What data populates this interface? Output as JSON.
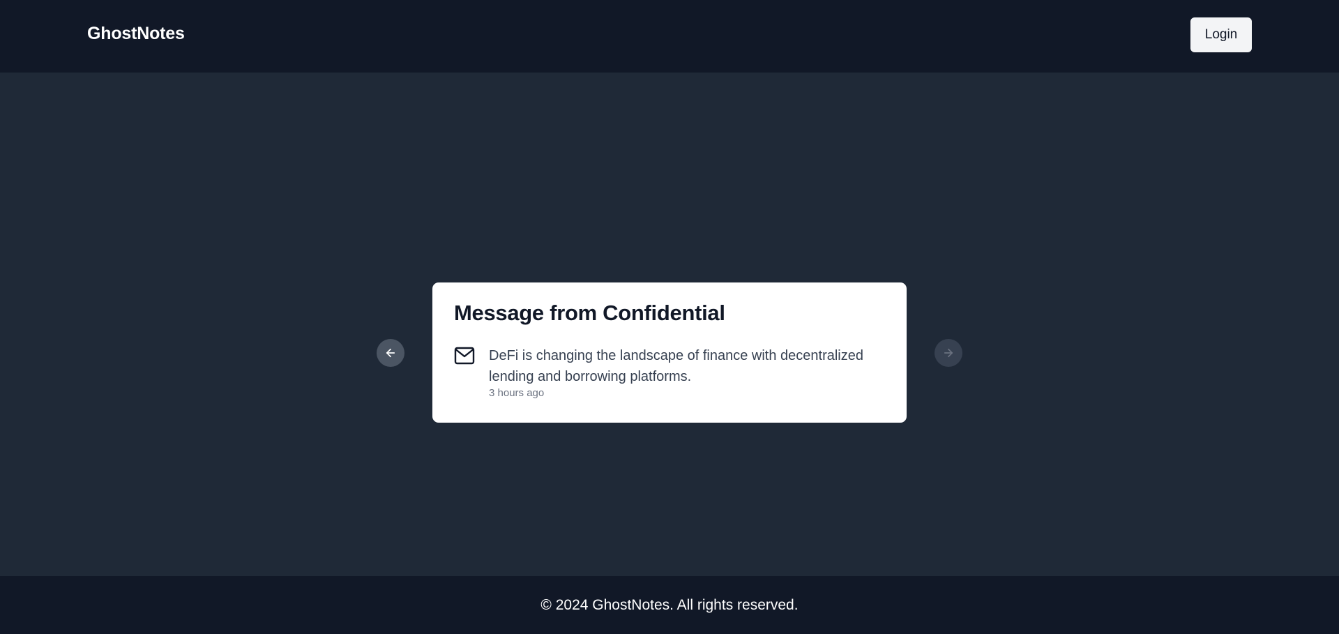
{
  "header": {
    "brand": "GhostNotes",
    "login_label": "Login"
  },
  "carousel": {
    "prev_icon": "arrow-left-icon",
    "next_icon": "arrow-right-icon",
    "card": {
      "title": "Message from Confidential",
      "icon": "mail-icon",
      "message": "DeFi is changing the landscape of finance with decentralized lending and borrowing platforms.",
      "timestamp": "3 hours ago"
    }
  },
  "footer": {
    "copyright": "© 2024 GhostNotes. All rights reserved."
  },
  "colors": {
    "header_bg": "#111827",
    "main_bg": "#1f2937",
    "card_bg": "#ffffff",
    "button_bg": "#f3f4f6"
  }
}
